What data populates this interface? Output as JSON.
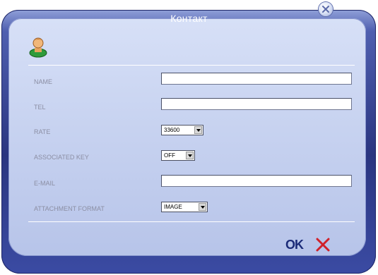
{
  "dialog": {
    "title": "Контакт",
    "close_icon": "close-icon",
    "user_icon": "contact-icon"
  },
  "fields": {
    "name": {
      "label": "NAME",
      "value": ""
    },
    "tel": {
      "label": "TEL",
      "value": ""
    },
    "rate": {
      "label": "RATE",
      "selected": "33600"
    },
    "associated_key": {
      "label": "ASSOCIATED KEY",
      "selected": "OFF"
    },
    "email": {
      "label": "E-MAIL",
      "value": ""
    },
    "attachment_format": {
      "label": "ATTACHMENT FORMAT",
      "selected": "IMAGE"
    }
  },
  "actions": {
    "ok_label": "OK",
    "cancel_icon": "cancel-icon"
  },
  "colors": {
    "frame": "#2a3580",
    "panel": "#c9d4f1",
    "ok": "#1b2b78",
    "cancel": "#d0212a"
  }
}
